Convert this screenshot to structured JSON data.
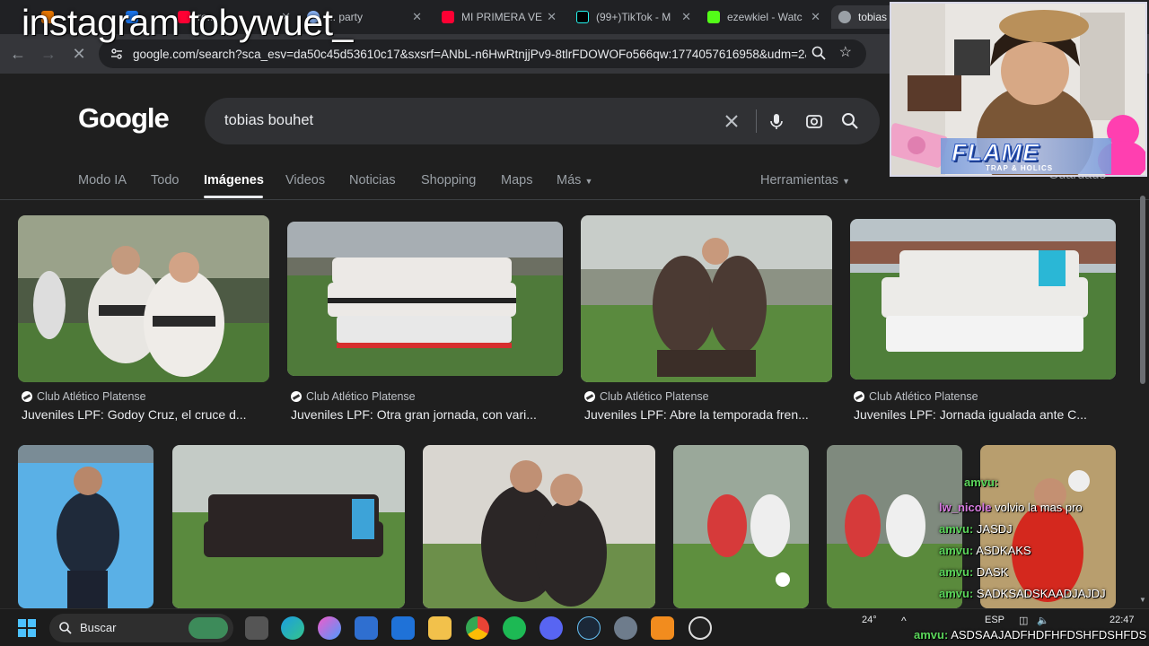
{
  "browser": {
    "tabs": [
      {
        "label": "",
        "fav_color": "#e37400"
      },
      {
        "label": "",
        "fav_color": "#1a73e8"
      },
      {
        "label": "ro...",
        "fav_color": "#ff0033"
      },
      {
        "label": "... party",
        "fav_color": "#8ab4f8"
      },
      {
        "label": "MI PRIMERA VE",
        "fav_color": "#ff0033"
      },
      {
        "label": "(99+)TikTok - M",
        "fav_color": "#000000"
      },
      {
        "label": "ezewkiel - Watc",
        "fav_color": "#53fc18"
      },
      {
        "label": "tobias",
        "fav_color": "#9aa0a6"
      }
    ],
    "url": "google.com/search?sca_esv=da50c45d53610c17&sxsrf=ANbL-n6HwRtnjjPv9-8tlrFDOWOFo566qw:1774057616958&udm=2&f..."
  },
  "google": {
    "logo": "Google",
    "query": "tobias bouhet",
    "tabs": [
      "Modo IA",
      "Todo",
      "Imágenes",
      "Videos",
      "Noticias",
      "Shopping",
      "Maps",
      "Más"
    ],
    "active_tab": "Imágenes",
    "tools": "Herramientas",
    "saved": "Guardado",
    "results_row1": [
      {
        "source": "Club Atlético Platense",
        "title": "Juveniles LPF: Godoy Cruz, el cruce d..."
      },
      {
        "source": "Club Atlético Platense",
        "title": "Juveniles LPF: Otra gran jornada, con vari..."
      },
      {
        "source": "Club Atlético Platense",
        "title": "Juveniles LPF: Abre la temporada fren..."
      },
      {
        "source": "Club Atlético Platense",
        "title": "Juveniles LPF: Jornada igualada ante C..."
      }
    ]
  },
  "taskbar": {
    "search_label": "Buscar",
    "weather": "24°",
    "lang": "ESP",
    "time": "22:47"
  },
  "overlay": {
    "handle": "instagram tobywuet_",
    "brand": "FLAME",
    "brand_sub": "TRAP & HOLICS",
    "chat": [
      {
        "user": "",
        "msg": "amvu:",
        "pink": false
      },
      {
        "user": "lw_nicole",
        "msg": "volvio la mas pro",
        "pink": true
      },
      {
        "user": "amvu:",
        "msg": "JASDJ",
        "pink": false
      },
      {
        "user": "amvu:",
        "msg": "ASDKAKS",
        "pink": false
      },
      {
        "user": "amvu:",
        "msg": "DASK",
        "pink": false
      },
      {
        "user": "amvu:",
        "msg": "SADKSADSKAADJAJDJ",
        "pink": false
      },
      {
        "user": "amvu:",
        "msg": "ASDSAAJADFHDFHFDSHFDSHFDS",
        "pink": false
      }
    ]
  },
  "colors": {
    "page_bg": "#1f1f1f",
    "chrome_bg": "#35363a",
    "chat_user": "#5bd65b",
    "chat_user_alt": "#d77be0"
  }
}
